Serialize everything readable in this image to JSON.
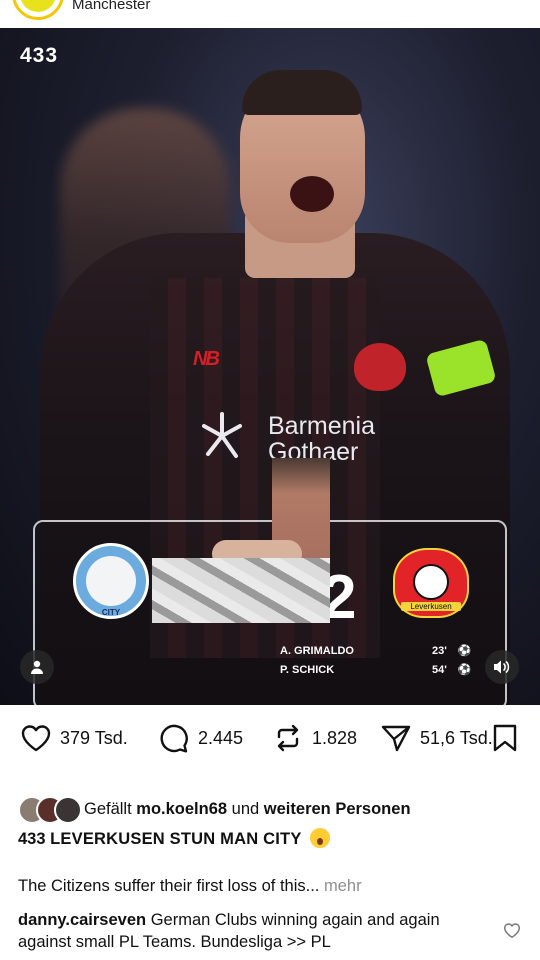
{
  "post_header": {
    "location": "Manchester"
  },
  "media": {
    "brand": "433",
    "sponsor": "Barmenia Gothaer",
    "score": "2",
    "home_crest_text": "CITY",
    "away_crest_text": "Leverkusen",
    "scorers": [
      {
        "name": "A. GRIMALDO",
        "minute": "23'"
      },
      {
        "name": "P. SCHICK",
        "minute": "54'"
      }
    ]
  },
  "actions": {
    "likes": "379 Tsd.",
    "comments": "2.445",
    "reposts": "1.828",
    "shares": "51,6 Tsd."
  },
  "liked_by": {
    "prefix": "Gefällt",
    "user": "mo.koeln68",
    "middle": "und",
    "suffix": "weiteren Personen"
  },
  "caption": {
    "user": "433",
    "title": "LEVERKUSEN STUN MAN CITY",
    "body": "The Citizens suffer their first loss of this...",
    "more": "mehr"
  },
  "comment": {
    "user": "danny.cairseven",
    "text": "German Clubs winning again and again against small PL Teams. Bundesliga >> PL"
  },
  "colors": {
    "story_ring": "#f7c600",
    "captain_band": "#9be22b",
    "city_blue": "#6cabdd",
    "leverkusen_red": "#e22428"
  }
}
